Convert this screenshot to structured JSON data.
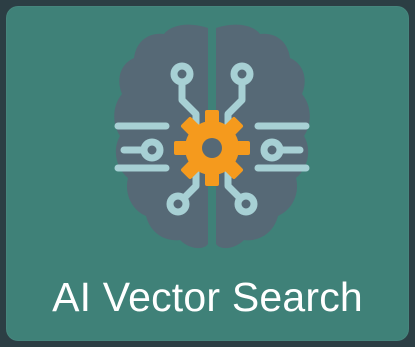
{
  "tile": {
    "title": "AI Vector Search",
    "icon": "brain-gear-icon"
  },
  "colors": {
    "page_background": "#2c3e44",
    "tile_background": "#3f8178",
    "brain_fill": "#566976",
    "circuit_lines": "#a7d0d4",
    "gear": "#f59a1d",
    "text": "#ffffff"
  }
}
